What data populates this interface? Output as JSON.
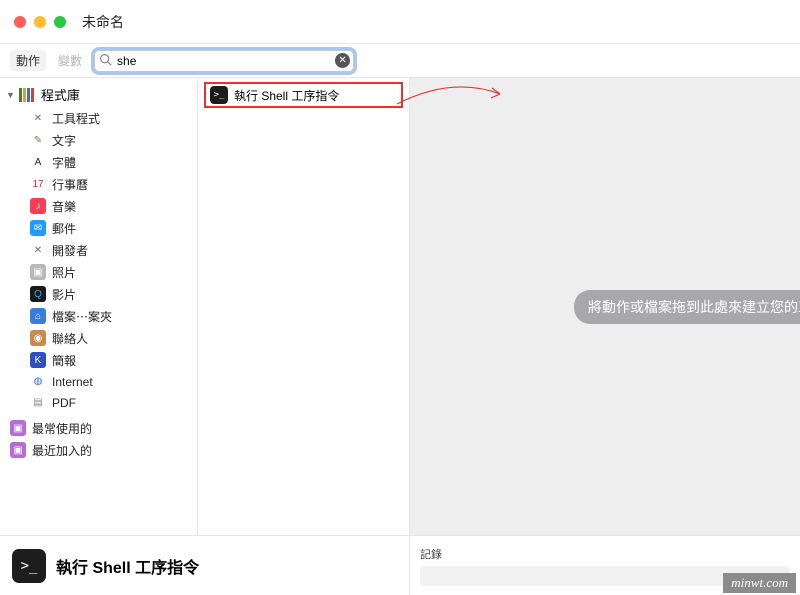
{
  "window": {
    "title": "未命名"
  },
  "toolbar": {
    "tab_actions": "動作",
    "tab_variables": "變數",
    "search_value": "she",
    "search_placeholder": ""
  },
  "library": {
    "header": "程式庫",
    "items": [
      {
        "label": "工具程式",
        "ic_bg": "transparent",
        "ic_txt": "✕",
        "ic_color": "#6e6e6e"
      },
      {
        "label": "文字",
        "ic_bg": "transparent",
        "ic_txt": "✎",
        "ic_color": "#8e7346"
      },
      {
        "label": "字體",
        "ic_bg": "transparent",
        "ic_txt": "A",
        "ic_color": "#222"
      },
      {
        "label": "行事曆",
        "ic_bg": "#ffffff",
        "ic_txt": "17",
        "ic_color": "#cc2b2b"
      },
      {
        "label": "音樂",
        "ic_bg": "#fa3c55",
        "ic_txt": "♪",
        "ic_color": "#fff"
      },
      {
        "label": "郵件",
        "ic_bg": "#1f9bff",
        "ic_txt": "✉",
        "ic_color": "#fff"
      },
      {
        "label": "開發者",
        "ic_bg": "transparent",
        "ic_txt": "✕",
        "ic_color": "#6e6e6e"
      },
      {
        "label": "照片",
        "ic_bg": "#b8b8b8",
        "ic_txt": "▣",
        "ic_color": "#fff"
      },
      {
        "label": "影片",
        "ic_bg": "#1a1a1a",
        "ic_txt": "Q",
        "ic_color": "#2aa7ff"
      },
      {
        "label": "檔案⋯案夾",
        "ic_bg": "#3b7bdc",
        "ic_txt": "⌂",
        "ic_color": "#fff"
      },
      {
        "label": "聯絡人",
        "ic_bg": "#c98a4c",
        "ic_txt": "◉",
        "ic_color": "#fff"
      },
      {
        "label": "簡報",
        "ic_bg": "#2e4fbf",
        "ic_txt": "K",
        "ic_color": "#fff"
      },
      {
        "label": "Internet",
        "ic_bg": "#ffffff",
        "ic_txt": "◍",
        "ic_color": "#3a6fd8"
      },
      {
        "label": "PDF",
        "ic_bg": "#ffffff",
        "ic_txt": "▤",
        "ic_color": "#888"
      }
    ],
    "smart": [
      {
        "label": "最常使用的"
      },
      {
        "label": "最近加入的"
      }
    ]
  },
  "results": {
    "items": [
      {
        "label": "執行 Shell 工序指令"
      }
    ]
  },
  "canvas": {
    "hint": "將動作或檔案拖到此處來建立您的工"
  },
  "footer": {
    "selected_label": "執行 Shell 工序指令",
    "log_label": "記錄"
  },
  "watermark": "minwt.com"
}
